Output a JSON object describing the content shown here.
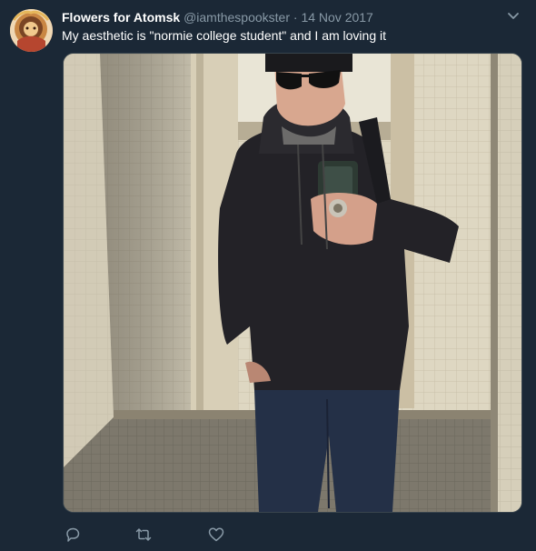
{
  "tweet": {
    "author_name": "Flowers for Atomsk",
    "handle": "@iamthespookster",
    "separator": "·",
    "date": "14 Nov 2017",
    "text": "My aesthetic is \"normie college student\" and I am loving it"
  },
  "icons": {
    "menu": "chevron-down-icon",
    "reply": "reply-icon",
    "retweet": "retweet-icon",
    "like": "heart-icon"
  },
  "colors": {
    "background": "#1b2836",
    "primary_text": "#ffffff",
    "secondary_text": "#8899a6",
    "icon": "#8899a6"
  }
}
